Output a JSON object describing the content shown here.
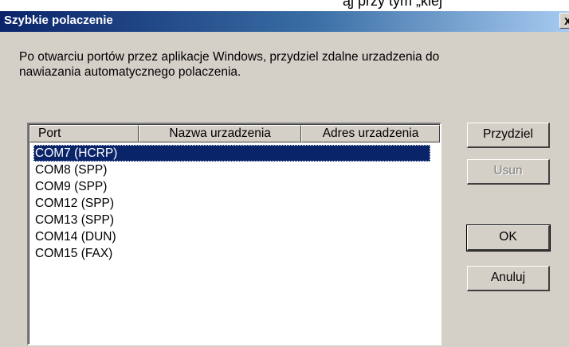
{
  "top_fragment": "ąj przy tym „klej",
  "window": {
    "title": "Szybkie polaczenie",
    "close_glyph": "x"
  },
  "description": "Po otwarciu portów przez aplikacje Windows, przydziel zdalne urzadzenia do nawiazania automatycznego polaczenia.",
  "list": {
    "columns": [
      "Port",
      "Nazwa urzadzenia",
      "Adres urzadzenia"
    ],
    "rows": [
      {
        "port": "COM7 (HCRP)",
        "selected": true
      },
      {
        "port": "COM8 (SPP)",
        "selected": false
      },
      {
        "port": "COM9 (SPP)",
        "selected": false
      },
      {
        "port": "COM12 (SPP)",
        "selected": false
      },
      {
        "port": "COM13 (SPP)",
        "selected": false
      },
      {
        "port": "COM14 (DUN)",
        "selected": false
      },
      {
        "port": "COM15 (FAX)",
        "selected": false
      }
    ]
  },
  "buttons": {
    "assign": "Przydziel",
    "remove": "Usun",
    "ok": "OK",
    "cancel": "Anuluj"
  },
  "colors": {
    "titlebar_start": "#0a246a",
    "titlebar_end": "#a6caf0",
    "dialog_bg": "#d4d0c8",
    "selection": "#0a246a"
  }
}
